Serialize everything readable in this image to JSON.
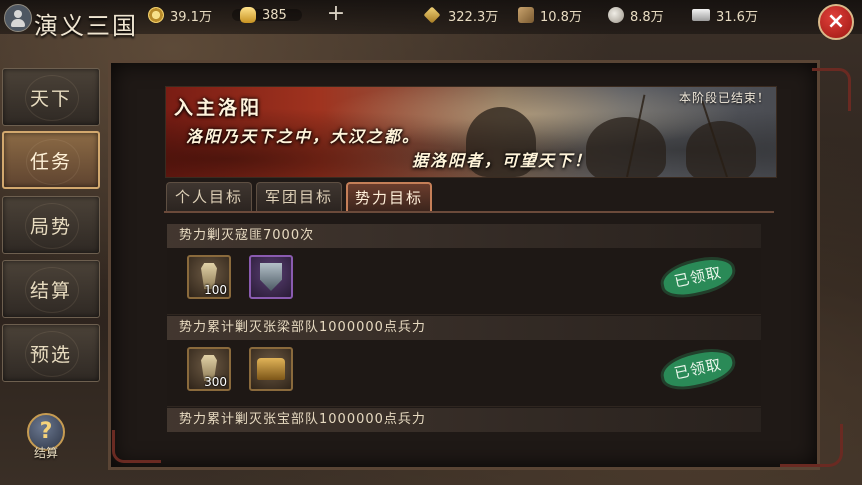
{
  "header": {
    "title": "演义三国",
    "resources": {
      "coins": "39.1万",
      "ingots": "385",
      "grain": "322.3万",
      "wood": "10.8万",
      "stone": "8.8万",
      "iron": "31.6万"
    },
    "close_label": "×",
    "plus_label": "+"
  },
  "sidebar": {
    "items": [
      {
        "label": "天下",
        "active": false
      },
      {
        "label": "任务",
        "active": true
      },
      {
        "label": "局势",
        "active": false
      },
      {
        "label": "结算",
        "active": false
      },
      {
        "label": "预选",
        "active": false
      }
    ],
    "help": {
      "symbol": "?",
      "label": "结算"
    }
  },
  "banner": {
    "title": "入主洛阳",
    "line1": "洛阳乃天下之中，大汉之都。",
    "line2": "据洛阳者，可望天下！",
    "status": "本阶段已结束！"
  },
  "tabs": [
    {
      "label": "个人目标",
      "active": false
    },
    {
      "label": "军团目标",
      "active": false
    },
    {
      "label": "势力目标",
      "active": true
    }
  ],
  "tasks": [
    {
      "title": "势力剿灭寇匪7000次",
      "rewards": [
        {
          "icon": "command-token-icon",
          "amount": "100"
        },
        {
          "icon": "shield-icon",
          "amount": ""
        }
      ],
      "stamp": "已领取"
    },
    {
      "title": "势力累计剿灭张梁部队1000000点兵力",
      "rewards": [
        {
          "icon": "command-token-icon",
          "amount": "300"
        },
        {
          "icon": "treasure-chest-icon",
          "amount": ""
        }
      ],
      "stamp": "已领取"
    },
    {
      "title": "势力累计剿灭张宝部队1000000点兵力"
    }
  ],
  "colors": {
    "accent_red": "#9c1712",
    "stamp_green": "#2a8a57",
    "active_tab_border": "#c57f58"
  }
}
